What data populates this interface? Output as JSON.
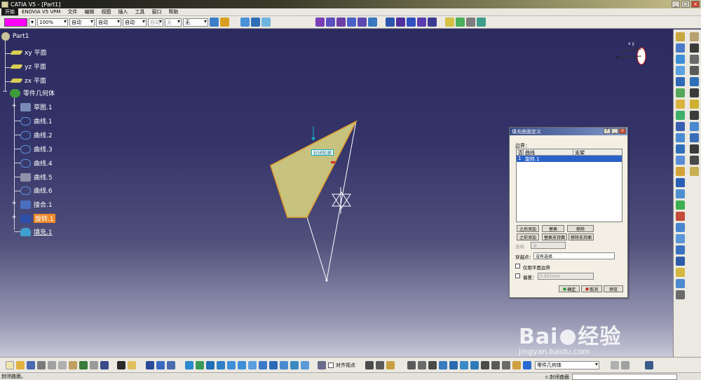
{
  "window": {
    "title": "CATIA V5 - [Part1]"
  },
  "menubar": {
    "items": [
      "开始",
      "ENOVIA V5 VPM",
      "文件",
      "编辑",
      "视图",
      "插入",
      "工具",
      "窗口",
      "帮助"
    ]
  },
  "toolbar_top": {
    "color": "#ff00ff",
    "transparency": "100%",
    "linetype": "自动",
    "lineweight": "自动",
    "point_style": "自动",
    "layer_a": "自动",
    "layer_b": "无",
    "layer_c": "无"
  },
  "tree": {
    "root": "Part1",
    "nodes": [
      {
        "label": "xy 平面"
      },
      {
        "label": "yz 平面"
      },
      {
        "label": "zx 平面"
      },
      {
        "label": "零件几何体"
      },
      {
        "label": "草图.1"
      },
      {
        "label": "曲线.1"
      },
      {
        "label": "曲线.2"
      },
      {
        "label": "曲线.3"
      },
      {
        "label": "曲线.4"
      },
      {
        "label": "曲线.5"
      },
      {
        "label": "曲线.6"
      },
      {
        "label": "接合.1"
      },
      {
        "label": "旋转.1"
      },
      {
        "label": "填充.1"
      }
    ]
  },
  "viewport": {
    "callout": "封闭轮廓",
    "compass_label": "x y"
  },
  "dialog": {
    "title": "填充曲面定义",
    "boundary_label": "边界：",
    "columns": [
      "否",
      "曲线",
      "支架"
    ],
    "rows": [
      {
        "no": "1",
        "curve": "旋转.1",
        "support": ""
      }
    ],
    "btn_add_after": "之后添加",
    "btn_replace": "替换",
    "btn_remove": "移除",
    "btn_add_before": "之前添加",
    "btn_replace_support": "替换支持面",
    "btn_remove_support": "移除支持面",
    "continuity_label": "连续",
    "continuity_value": "点",
    "passing_point_label": "穿越点：",
    "passing_point_value": "没有选择",
    "plane_only_label": "仅限平面边界",
    "deviation_label": "偏差：",
    "deviation_value": "0.001mm",
    "ok": "确定",
    "cancel": "取消",
    "preview": "预览"
  },
  "toolbar_bottom": {
    "align_label": "对齐视点",
    "body_select": "零件几何体"
  },
  "statusbar": {
    "left": "封闭曲面。",
    "right": "c:封闭曲面"
  },
  "watermark": {
    "brand": "Bai",
    "brand2": "经验",
    "url": "jingyan.baidu.com"
  }
}
